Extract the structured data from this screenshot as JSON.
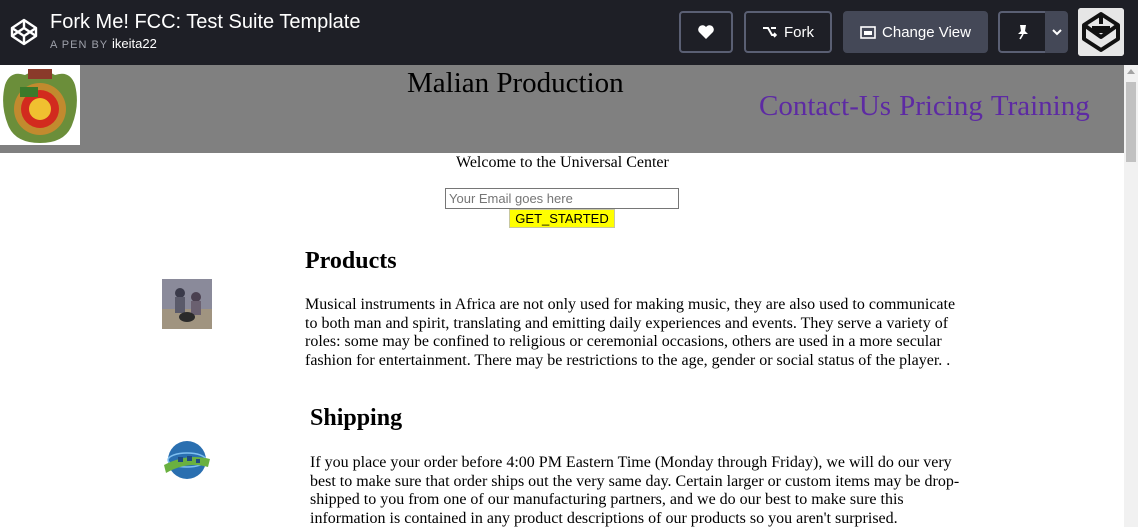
{
  "codepen": {
    "title": "Fork Me! FCC: Test Suite Template",
    "by_label": "A PEN BY",
    "author": "ikeita22",
    "fork_label": "Fork",
    "change_view_label": "Change View"
  },
  "site": {
    "title": "Malian Production",
    "nav": [
      "Contact-Us",
      "Pricing",
      "Training"
    ],
    "welcome": "Welcome to the Universal Center",
    "email_placeholder": "Your Email goes here",
    "get_started": "GET_STARTED"
  },
  "sections": [
    {
      "heading": "Products",
      "text": "Musical instruments in Africa are not only used for making music, they are also used to communicate to both man and spirit, translating and emitting daily experiences and events. They serve a variety of roles: some may be confined to religious or ceremonial occasions, others are used in a more secular fashion for entertainment. There may be restrictions to the age, gender or social status of the player. ."
    },
    {
      "heading": "Shipping",
      "text": "If you place your order before 4:00 PM Eastern Time (Monday through Friday), we will do our very best to make sure that order ships out the very same day. Certain larger or custom items may be drop-shipped to you from one of our manufacturing partners, and we do our best to make sure this information is contained in any product descriptions of our products so you aren't surprised."
    }
  ],
  "colors": {
    "topbar": "#1e1f26",
    "header": "#808080",
    "nav": "#5d2aa3",
    "button": "#ffff00"
  }
}
